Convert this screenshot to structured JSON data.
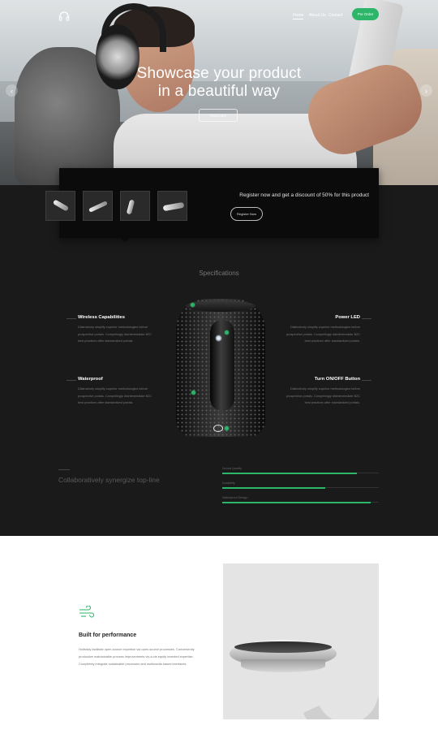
{
  "nav": {
    "logo_icon": "headphones-icon",
    "items": [
      "Home",
      "About Us",
      "Contact"
    ],
    "cta": "Pre Order"
  },
  "hero": {
    "title_line1": "Showcase your product",
    "title_line2": "in a beautiful way",
    "button": "Find more",
    "prev_icon": "chevron-left-icon",
    "next_icon": "chevron-right-icon"
  },
  "promo": {
    "text": "Register now and get a discount of 50% for this product",
    "button": "Register Now"
  },
  "specs": {
    "title": "Specifications",
    "left": [
      {
        "title": "Wireless Capabilities",
        "text": "Distinctively simplify superior methodologies before prospective portals. Compellingly disintermediate B2C best practices after standardized portals."
      },
      {
        "title": "Waterproof",
        "text": "Distinctively simplify superior methodologies before prospective portals. Compellingly disintermediate B2C best practices after standardized portals."
      }
    ],
    "right": [
      {
        "title": "Power LED",
        "text": "Distinctively simplify superior methodologies before prospective portals. Compellingly disintermediate B2C best practices after standardized portals."
      },
      {
        "title": "Turn ON/OFF Button",
        "text": "Distinctively simplify superior methodologies before prospective portals. Compellingly disintermediate B2C best practices after standardized portals."
      }
    ]
  },
  "collab": {
    "text": "Collaboratively synergize top-line"
  },
  "bars": [
    {
      "label": "Sound Quality",
      "value": 0.86
    },
    {
      "label": "Durability",
      "value": 0.66
    },
    {
      "label": "Waterproof Design",
      "value": 0.95
    }
  ],
  "performance": {
    "icon": "wind-icon",
    "title": "Built for performance",
    "text": "Holisticly facilitate open-source expertise via open-source processes. Conveniently productize maintainable process improvements vis-a-vis equity invested expertise. Completely integrate sustainable processes and multimedia based interfaces."
  },
  "colors": {
    "accent": "#2db56a",
    "dark": "#1a1a1a",
    "band": "#0b0b0b"
  }
}
